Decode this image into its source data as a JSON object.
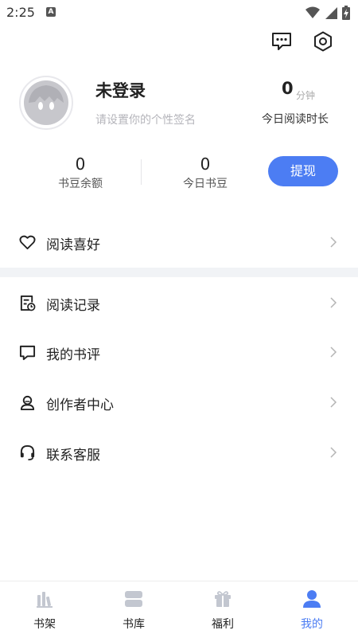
{
  "status_bar": {
    "time": "2:25",
    "notification_glyph": "A"
  },
  "profile": {
    "username": "未登录",
    "signature_placeholder": "请设置你的个性签名",
    "read_time_value": "0",
    "read_time_unit": "分钟",
    "read_time_label": "今日阅读时长"
  },
  "stats": {
    "balance_value": "0",
    "balance_label": "书豆余额",
    "today_value": "0",
    "today_label": "今日书豆",
    "withdraw_label": "提现"
  },
  "menu": {
    "preference": "阅读喜好",
    "history": "阅读记录",
    "reviews": "我的书评",
    "creator": "创作者中心",
    "support": "联系客服",
    "chevron": ">"
  },
  "nav": {
    "shelf": "书架",
    "library": "书库",
    "welfare": "福利",
    "mine": "我的"
  },
  "colors": {
    "accent": "#4c7df3",
    "nav_inactive_icon": "#c3c7d0",
    "section_gap": "#f1f3f6"
  }
}
